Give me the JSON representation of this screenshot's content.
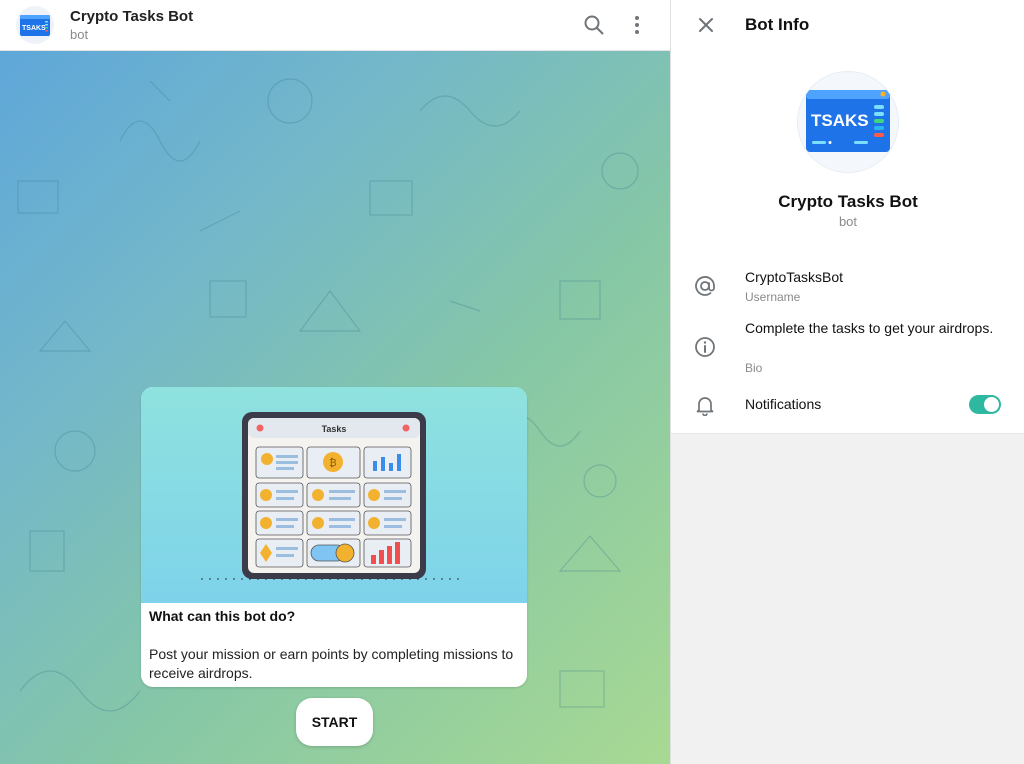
{
  "chat": {
    "title": "Crypto Tasks Bot",
    "subtitle": "bot",
    "avatar_text": "TSAKS"
  },
  "bot_card": {
    "image_header": "Tasks",
    "title": "What can this bot do?",
    "description": "Post your mission or earn points by completing missions to receive airdrops."
  },
  "start_button": "START",
  "info": {
    "panel_title": "Bot Info",
    "name": "Crypto Tasks Bot",
    "subtitle": "bot",
    "avatar_text": "TSAKS",
    "username": "CryptoTasksBot",
    "username_label": "Username",
    "bio": "Complete the tasks to get your airdrops.",
    "bio_label": "Bio",
    "notifications_label": "Notifications",
    "notifications_on": true
  },
  "colors": {
    "accent": "#2eb8a0",
    "logo_blue": "#1e73e8"
  }
}
